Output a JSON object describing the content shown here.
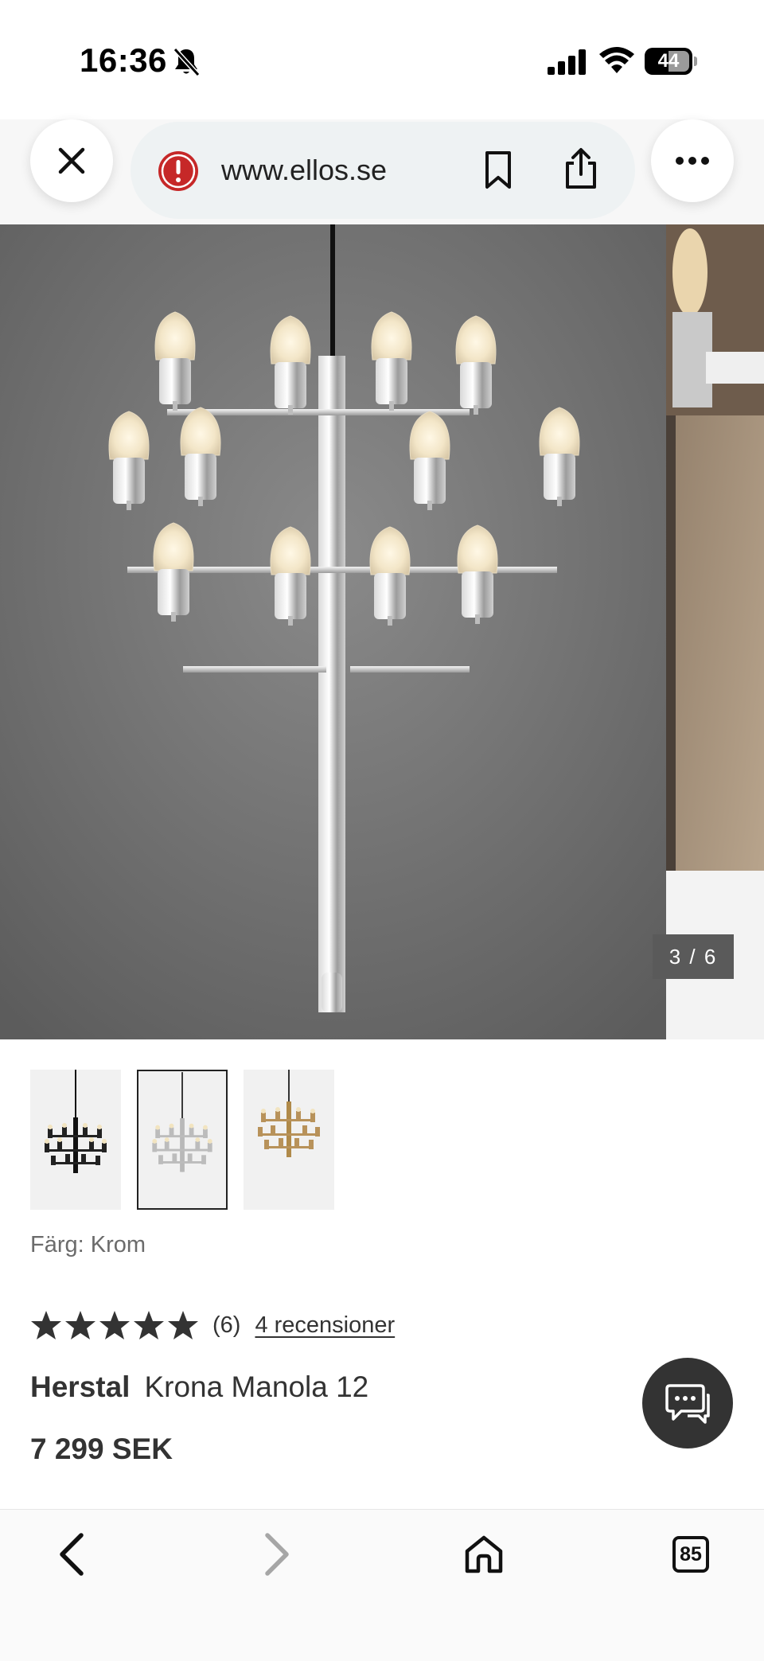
{
  "status_bar": {
    "time": "16:36",
    "battery": "44",
    "icons": [
      "bell-slash-icon",
      "cellular-signal-icon",
      "wifi-icon",
      "battery-icon"
    ]
  },
  "browser": {
    "url": "www.ellos.se",
    "icons": [
      "close-icon",
      "warning-icon",
      "bookmark-icon",
      "share-icon",
      "more-icon"
    ]
  },
  "gallery": {
    "counter": "3 / 6"
  },
  "product": {
    "color_label": "Färg: Krom",
    "rating_value": 5,
    "rating_count": "(6)",
    "reviews_link": "4 recensioner",
    "brand": "Herstal",
    "name": "Krona Manola 12",
    "price": "7 299 SEK",
    "thumbnails": [
      "black",
      "chrome",
      "brass"
    ],
    "selected_thumbnail": "chrome"
  },
  "toolbar": {
    "tabs_count": "85",
    "icons": [
      "back-icon",
      "forward-icon",
      "home-icon",
      "tabs-icon"
    ]
  },
  "colors": {
    "accent_warning": "#c62828",
    "chat_button": "#333333",
    "text": "#333333"
  }
}
